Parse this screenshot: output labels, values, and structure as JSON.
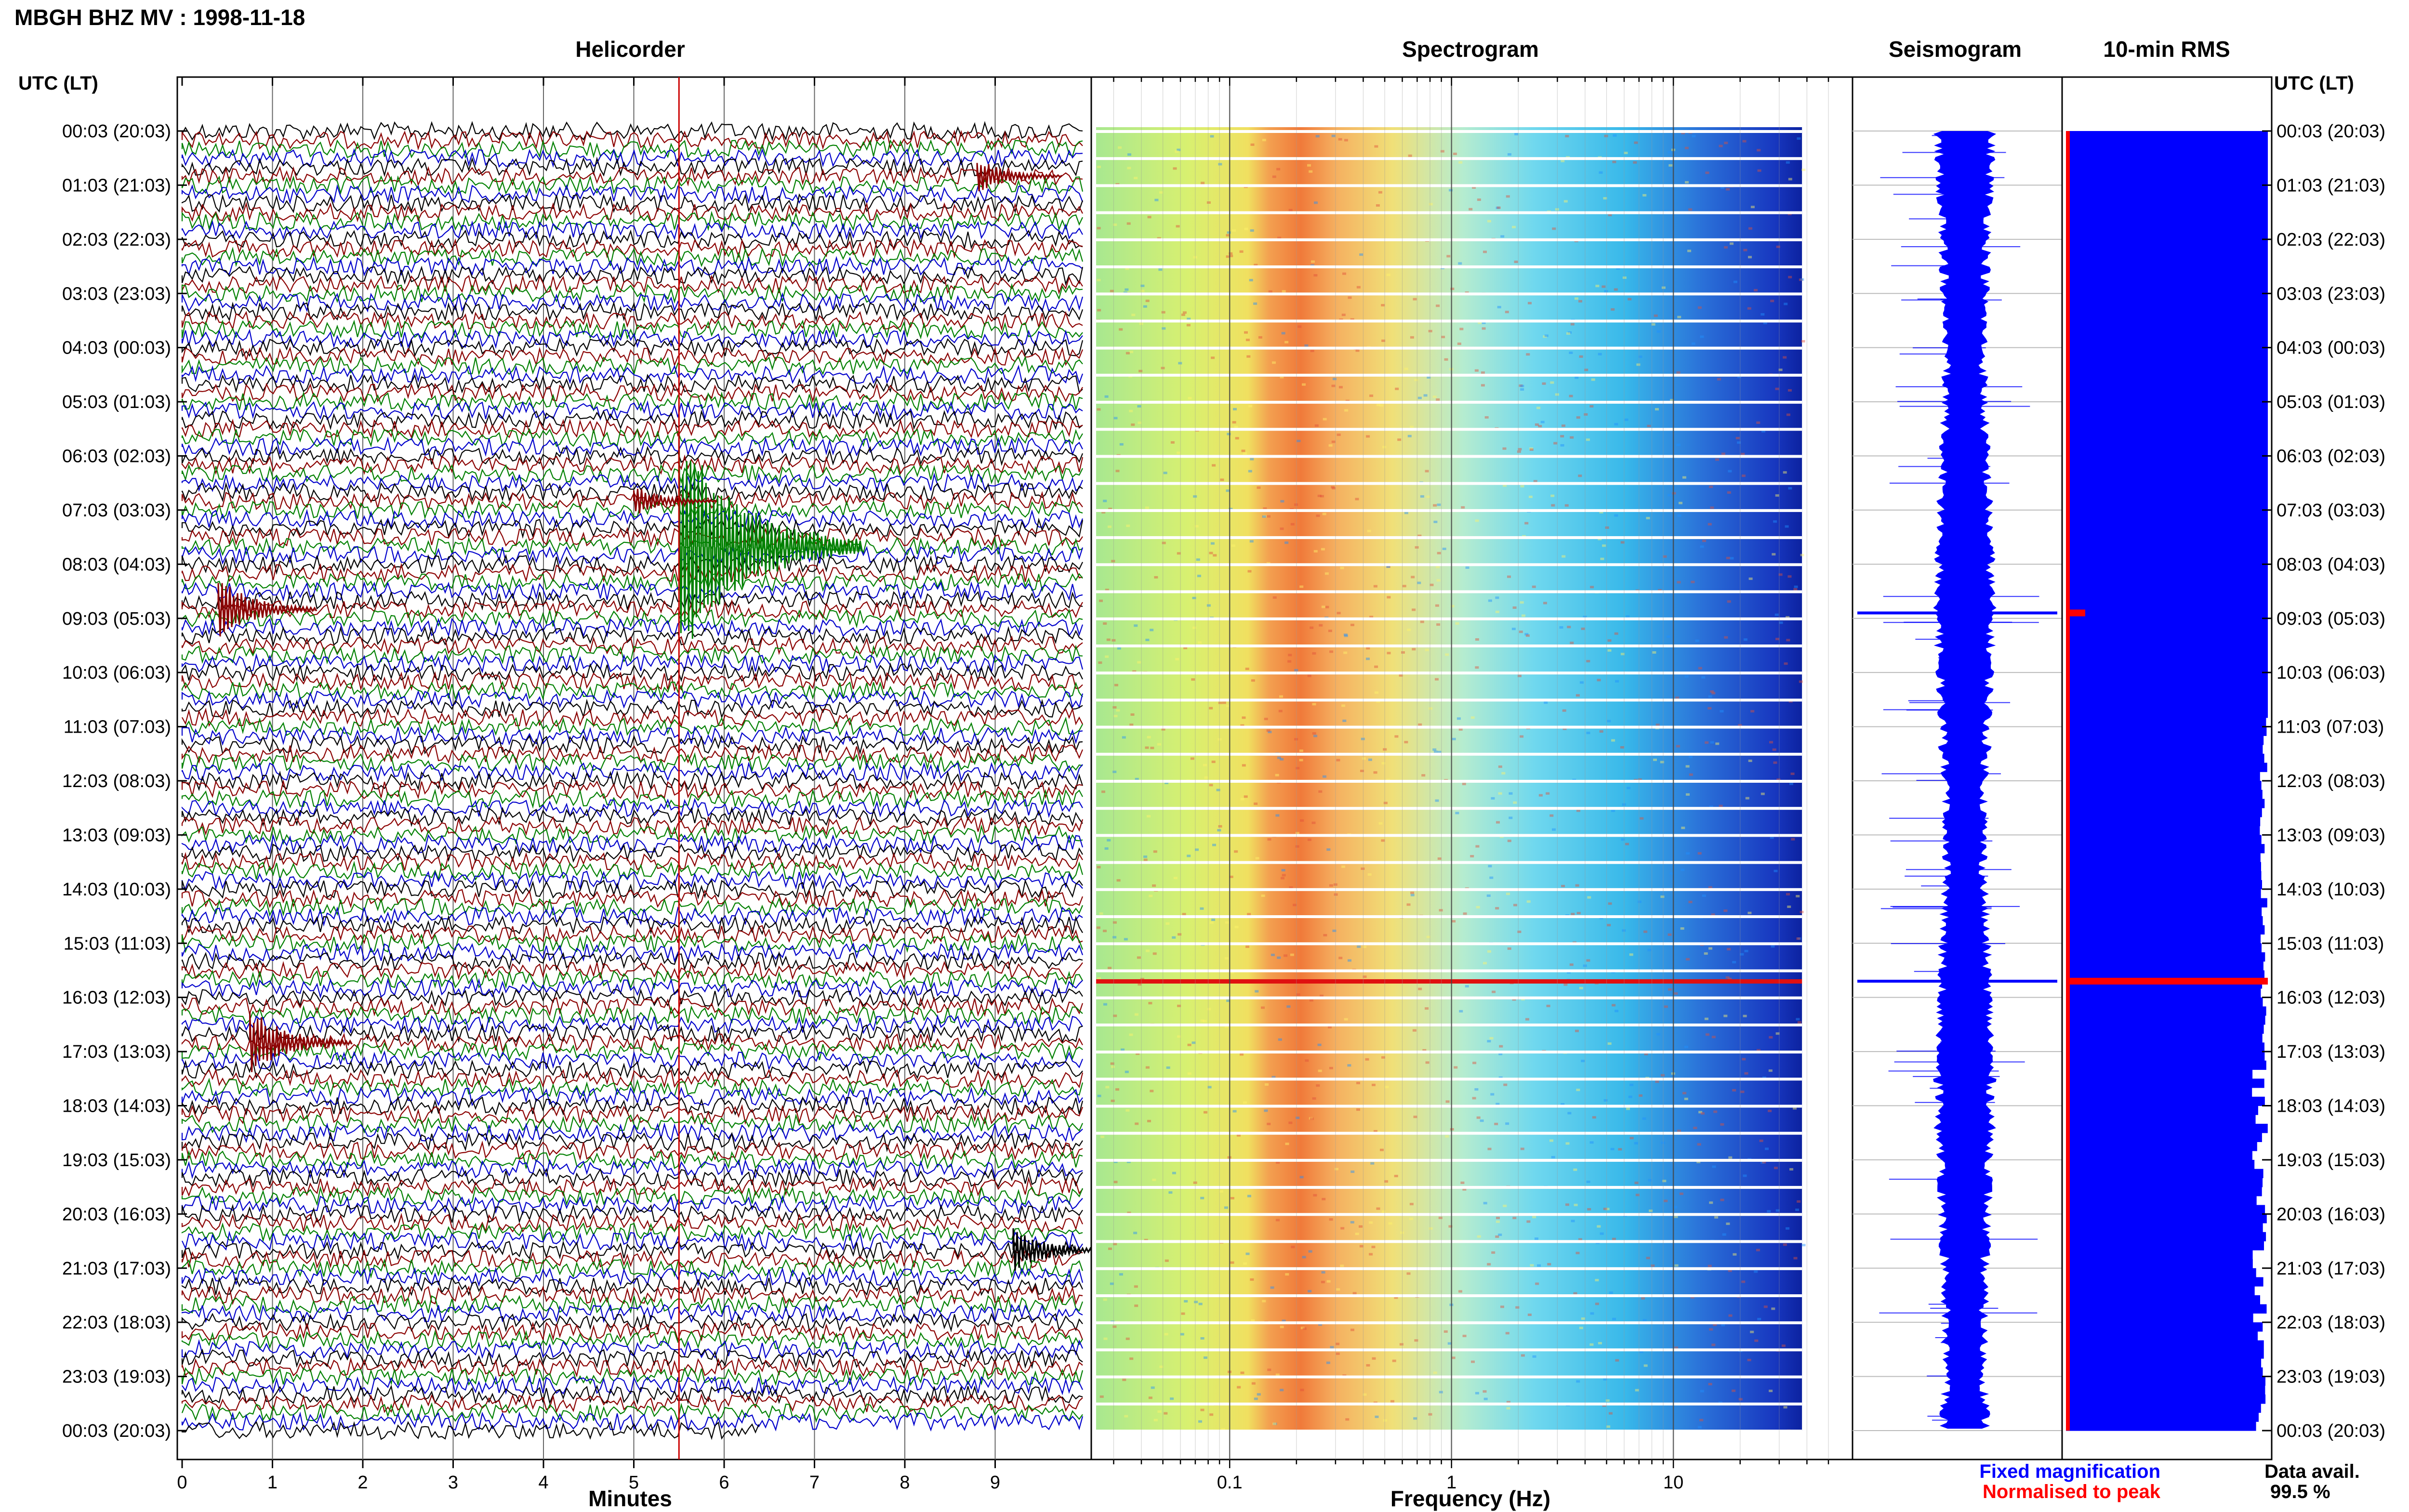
{
  "page_title": "MBGH BHZ MV : 1998-11-18",
  "panel_titles": {
    "helicorder": "Helicorder",
    "spectrogram": "Spectrogram",
    "seismogram": "Seismogram",
    "rms": "10-min RMS"
  },
  "utc_header_left": "UTC (LT)",
  "utc_header_right": "UTC (LT)",
  "legend": {
    "fixed": "Fixed magnification",
    "normalised": "Normalised to peak"
  },
  "data_avail": {
    "label": "Data avail.",
    "value": "99.5 %"
  },
  "colors": {
    "trace_cycle": [
      "#000000",
      "#8b0000",
      "#008000",
      "#0000cc"
    ],
    "fixed": "#0000ff",
    "normalised": "#ff0000",
    "marker": "#cc0000"
  },
  "chart_data": [
    {
      "type": "line",
      "name": "helicorder",
      "xlabel": "Minutes",
      "xlim": [
        0,
        10
      ],
      "xticks": [
        "0",
        "1",
        "2",
        "3",
        "4",
        "5",
        "6",
        "7",
        "8",
        "9"
      ],
      "row_labels": [
        "00:03 (20:03)",
        "01:03 (21:03)",
        "02:03 (22:03)",
        "03:03 (23:03)",
        "04:03 (00:03)",
        "05:03 (01:03)",
        "06:03 (02:03)",
        "07:03 (03:03)",
        "08:03 (04:03)",
        "09:03 (05:03)",
        "10:03 (06:03)",
        "11:03 (07:03)",
        "12:03 (08:03)",
        "13:03 (09:03)",
        "14:03 (10:03)",
        "15:03 (11:03)",
        "16:03 (12:03)",
        "17:03 (13:03)",
        "18:03 (14:03)",
        "19:03 (15:03)",
        "20:03 (16:03)",
        "21:03 (17:03)",
        "22:03 (18:03)",
        "23:03 (19:03)",
        "00:03 (20:03)"
      ],
      "rows_per_hour": 6,
      "events": [
        {
          "hour": 7.6,
          "minute": 5.5,
          "amplitude": 6.0
        },
        {
          "hour": 8.9,
          "minute": 0.4,
          "amplitude": 1.6
        },
        {
          "hour": 16.8,
          "minute": 0.75,
          "amplitude": 1.8
        },
        {
          "hour": 20.7,
          "minute": 9.2,
          "amplitude": 1.2
        },
        {
          "hour": 0.9,
          "minute": 8.8,
          "amplitude": 0.9
        },
        {
          "hour": 6.8,
          "minute": 5.0,
          "amplitude": 0.8
        }
      ]
    },
    {
      "type": "heatmap",
      "name": "spectrogram",
      "xlabel": "Frequency (Hz)",
      "xscale": "log",
      "xlim": [
        0.025,
        50
      ],
      "xticks": [
        "0.1",
        "1",
        "10"
      ],
      "dominant_band_hz": [
        0.2,
        0.5
      ],
      "strong_rows_hour": [
        15.7
      ]
    },
    {
      "type": "area",
      "name": "seismogram",
      "amplitude": "fixed magnification"
    },
    {
      "type": "bar",
      "name": "10-min RMS",
      "orientation": "horizontal",
      "peak_rows_hour": [
        8.9,
        15.7
      ],
      "data_availability_percent": 99.5
    }
  ]
}
